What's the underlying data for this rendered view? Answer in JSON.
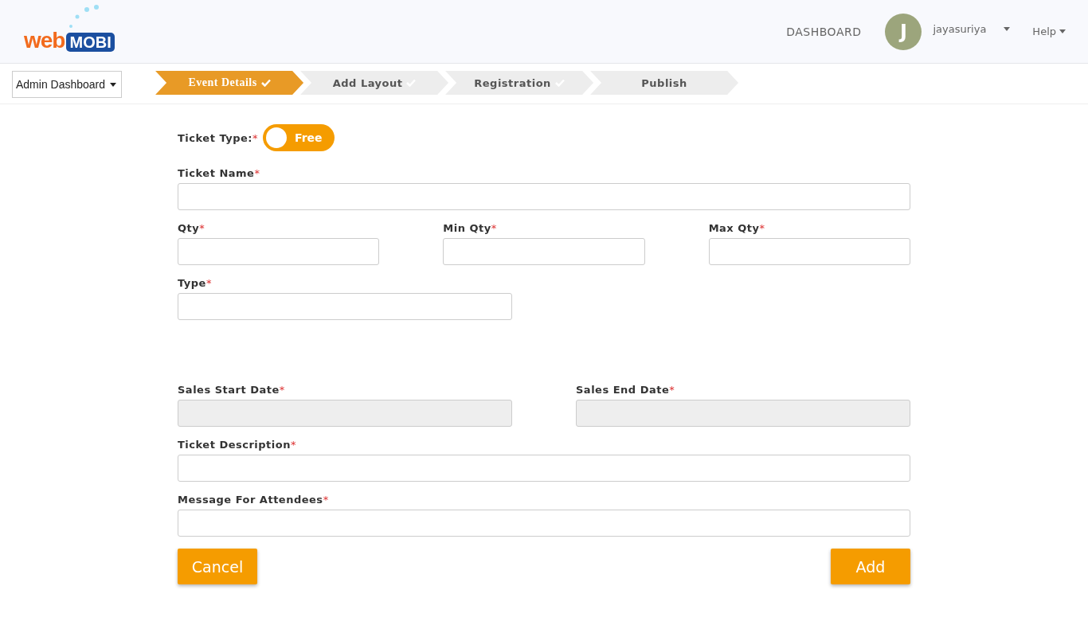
{
  "header": {
    "logo": {
      "web": "web",
      "mobi": "MOBI"
    },
    "nav_link": "DASHBOARD",
    "user": {
      "initial": "J",
      "name": "jayasuriya"
    },
    "help": "Help"
  },
  "dashboard_select": "Admin Dashboard",
  "steps": [
    {
      "label": "Event Details",
      "selected": true,
      "done": true
    },
    {
      "label": "Add Layout",
      "selected": false,
      "done": true
    },
    {
      "label": "Registration",
      "selected": false,
      "done": true
    },
    {
      "label": "Publish",
      "selected": false,
      "done": false
    }
  ],
  "ticket_type": {
    "label": "Ticket Type:",
    "marker": "*",
    "toggle_label": "Free"
  },
  "sections": [
    {
      "rows": [
        {
          "kind": "full",
          "fields": [
            {
              "label": "Ticket Name",
              "marker": "*",
              "disabled": false
            }
          ]
        },
        {
          "kind": "triple",
          "fields": [
            {
              "label": "Qty",
              "marker": "*",
              "disabled": false
            },
            {
              "label": "Min Qty",
              "marker": "*",
              "disabled": false
            },
            {
              "label": "Max Qty",
              "marker": "*",
              "disabled": false
            }
          ]
        },
        {
          "kind": "half",
          "fields": [
            {
              "label": "Type",
              "marker": "*",
              "disabled": false
            }
          ]
        }
      ]
    },
    {
      "rows": [
        {
          "kind": "half",
          "fields": [
            {
              "label": "Sales Start Date",
              "marker": "*",
              "disabled": true
            },
            {
              "label": "Sales End Date",
              "marker": "*",
              "disabled": true
            }
          ]
        },
        {
          "kind": "full",
          "fields": [
            {
              "label": "Ticket Description",
              "marker": "*",
              "disabled": false
            }
          ]
        },
        {
          "kind": "full",
          "fields": [
            {
              "label": "Message For Attendees",
              "marker": "*",
              "disabled": false
            }
          ]
        }
      ]
    }
  ],
  "buttons": {
    "cancel": "Cancel",
    "add": "Add"
  }
}
